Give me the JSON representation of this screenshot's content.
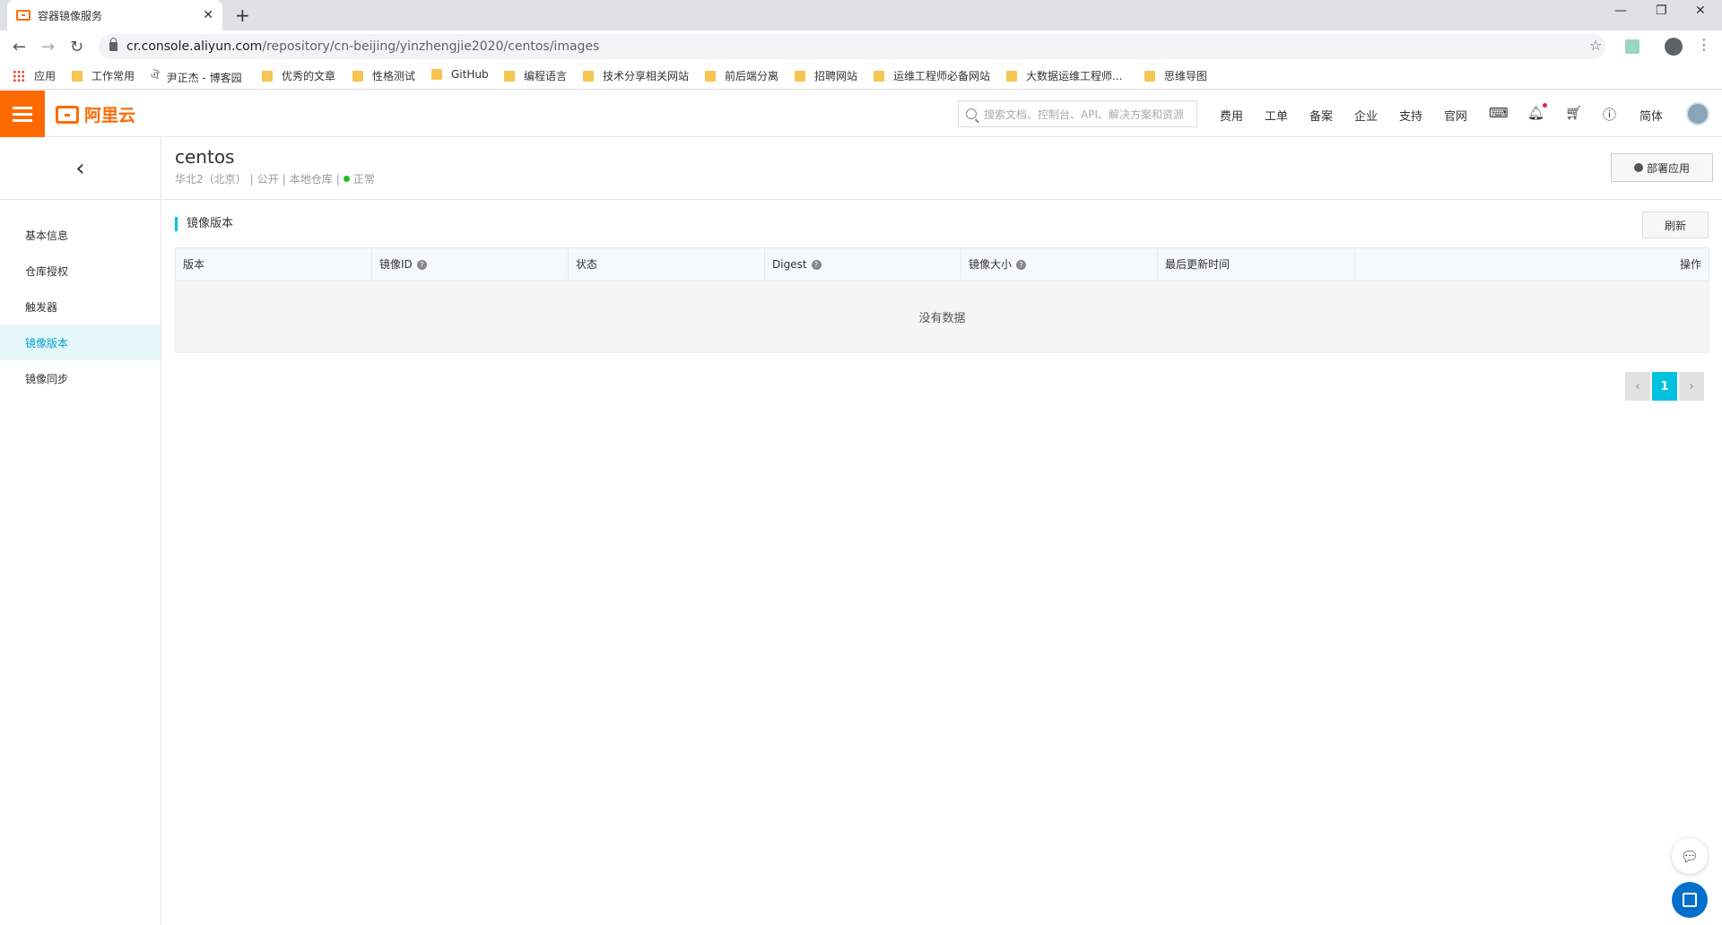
{
  "browser": {
    "tab_title": "容器镜像服务",
    "url_host": "cr.console.aliyun.com",
    "url_path": "/repository/cn-beijing/yinzhengjie2020/centos/images",
    "bookmarks": [
      "应用",
      "工作常用",
      "尹正杰 - 博客园",
      "优秀的文章",
      "性格测试",
      "GitHub",
      "编程语言",
      "技术分享相关网站",
      "前后端分离",
      "招聘网站",
      "运维工程师必备网站",
      "大数据运维工程师...",
      "思维导图"
    ]
  },
  "topbar": {
    "logo_text": "阿里云",
    "search_placeholder": "搜索文档、控制台、API、解决方案和资源",
    "nav": [
      "费用",
      "工单",
      "备案",
      "企业",
      "支持",
      "官网"
    ],
    "lang": "简体",
    "accent": "#ff6a00"
  },
  "sidebar": {
    "items": [
      {
        "label": "基本信息"
      },
      {
        "label": "仓库授权"
      },
      {
        "label": "触发器"
      },
      {
        "label": "镜像版本",
        "active": true
      },
      {
        "label": "镜像同步"
      }
    ]
  },
  "repo": {
    "name": "centos",
    "region": "华北2（北京）",
    "visibility": "公开",
    "type": "本地仓库",
    "status": "正常",
    "deploy_label": "部署应用"
  },
  "images": {
    "section_title": "镜像版本",
    "refresh_label": "刷新",
    "columns": [
      "版本",
      "镜像ID",
      "状态",
      "Digest",
      "镜像大小",
      "最后更新时间",
      "操作"
    ],
    "empty_text": "没有数据",
    "current_page": "1"
  }
}
